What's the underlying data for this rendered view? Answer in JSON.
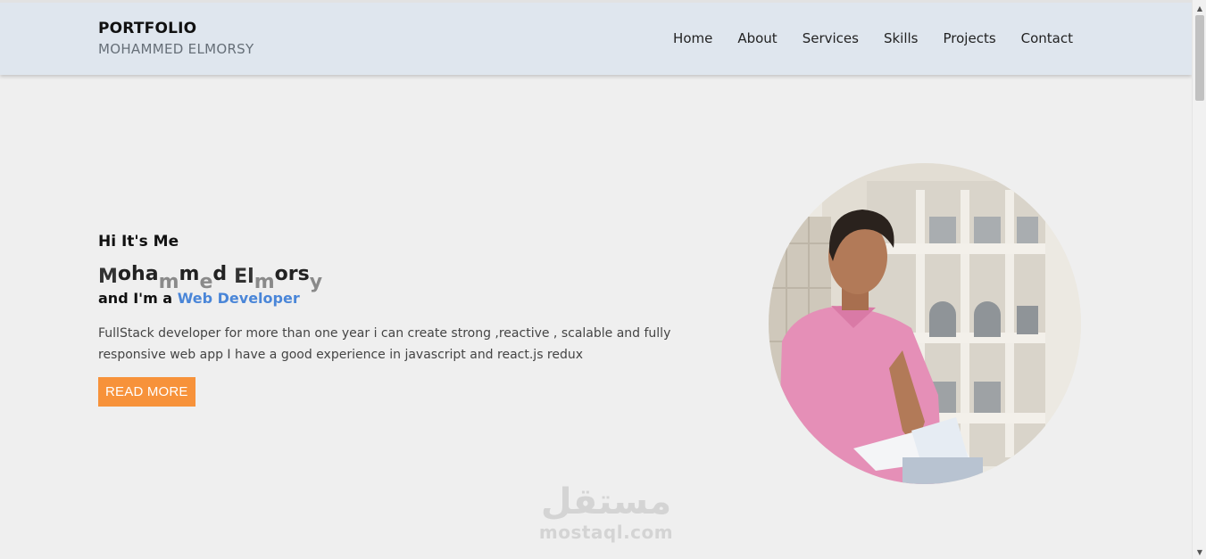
{
  "header": {
    "brand_title": "PORTFOLIO",
    "brand_subtitle": "MOHAMMED ELMORSY",
    "nav": [
      {
        "label": "Home"
      },
      {
        "label": "About"
      },
      {
        "label": "Services"
      },
      {
        "label": "Skills"
      },
      {
        "label": "Projects"
      },
      {
        "label": "Contact"
      }
    ]
  },
  "hero": {
    "greeting": "Hi It's Me",
    "name_letters": [
      "M",
      "o",
      "h",
      "a",
      "m",
      "m",
      "e",
      "d",
      " ",
      "E",
      "l",
      "m",
      "o",
      "r",
      "s",
      "y"
    ],
    "role_prefix": "and I'm a",
    "role_accent": "Web Developer",
    "description": "FullStack developer for more than one year i can create strong ,reactive , scalable and fully responsive web app I have a good experience in javascript and react.js redux",
    "button_label": "READ MORE"
  },
  "watermark": {
    "arabic": "مستقل",
    "latin": "mostaql.com"
  },
  "scrollbar": {
    "up_arrow": "▲",
    "down_arrow": "▼"
  },
  "colors": {
    "header_bg": "#dfe6ee",
    "page_bg": "#efefef",
    "accent_blue": "#4a86d8",
    "button_orange": "#f7923a"
  },
  "icons": {
    "photo": "profile-photo-image"
  }
}
